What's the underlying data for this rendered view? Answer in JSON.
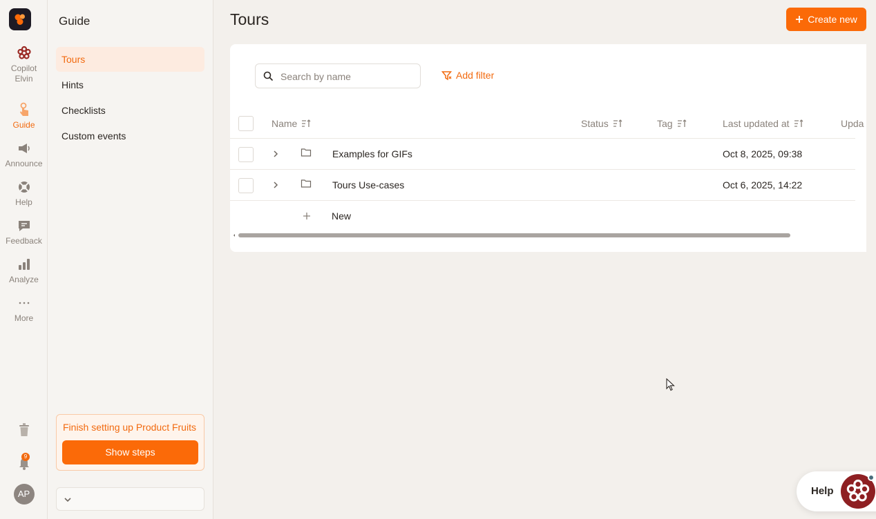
{
  "rail": {
    "items": [
      {
        "label": "Copilot Elvin",
        "icon": "copilot-flower-icon"
      },
      {
        "label": "Guide",
        "icon": "guide-hand-icon",
        "active": true
      },
      {
        "label": "Announce",
        "icon": "megaphone-icon"
      },
      {
        "label": "Help",
        "icon": "lifebuoy-icon"
      },
      {
        "label": "Feedback",
        "icon": "feedback-bubble-icon"
      },
      {
        "label": "Analyze",
        "icon": "bar-chart-icon"
      },
      {
        "label": "More",
        "icon": "ellipsis-icon"
      }
    ],
    "notification_count": "9",
    "avatar_initials": "AP"
  },
  "sidebar": {
    "title": "Guide",
    "items": [
      {
        "label": "Tours",
        "active": true
      },
      {
        "label": "Hints"
      },
      {
        "label": "Checklists"
      },
      {
        "label": "Custom events"
      }
    ],
    "setup_text": "Finish setting up Product Fruits",
    "setup_button": "Show steps"
  },
  "main": {
    "title": "Tours",
    "create_button": "Create new",
    "search_placeholder": "Search by name",
    "add_filter": "Add filter",
    "columns": [
      "Name",
      "Status",
      "Tag",
      "Last updated at",
      "Upda"
    ],
    "rows": [
      {
        "name": "Examples for GIFs",
        "status": "",
        "tag": "",
        "updated": "Oct 8, 2025, 09:38"
      },
      {
        "name": "Tours Use-cases",
        "status": "",
        "tag": "",
        "updated": "Oct 6, 2025, 14:22"
      }
    ],
    "new_row_label": "New"
  },
  "help_widget": {
    "label": "Help"
  },
  "colors": {
    "accent": "#fb6a08",
    "background": "#f3f0ec",
    "brand_dark": "#8e1f22"
  }
}
